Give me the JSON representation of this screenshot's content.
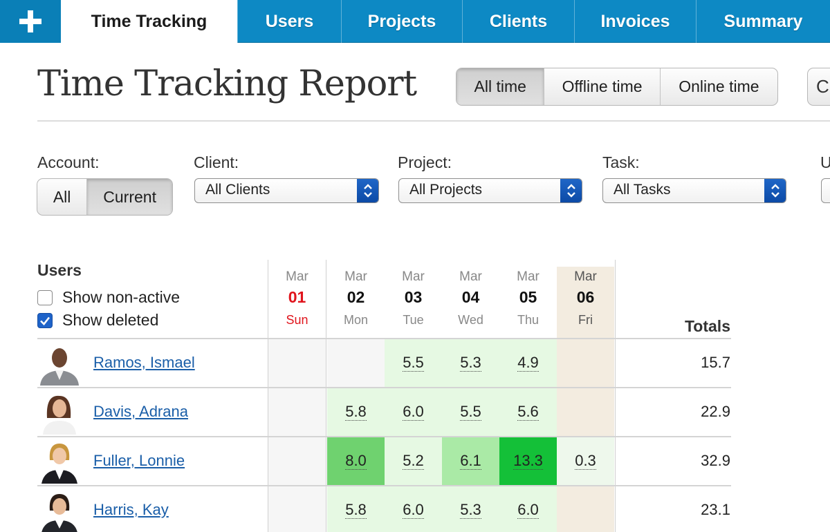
{
  "nav": {
    "add_icon": "plus-icon",
    "tabs": [
      {
        "label": "Time Tracking",
        "active": true
      },
      {
        "label": "Users"
      },
      {
        "label": "Projects"
      },
      {
        "label": "Clients"
      },
      {
        "label": "Invoices"
      },
      {
        "label": "Summary"
      }
    ]
  },
  "page": {
    "title": "Time Tracking Report",
    "time_filter": [
      {
        "label": "All time",
        "selected": true
      },
      {
        "label": "Offline time"
      },
      {
        "label": "Online time"
      }
    ],
    "cut_button_glyph": "C"
  },
  "filters": {
    "account_label": "Account:",
    "account_options": [
      {
        "label": "All"
      },
      {
        "label": "Current",
        "selected": true
      }
    ],
    "client_label": "Client:",
    "client_value": "All Clients",
    "project_label": "Project:",
    "project_value": "All Projects",
    "task_label": "Task:",
    "task_value": "All Tasks",
    "cut_label": "U"
  },
  "users_panel": {
    "heading": "Users",
    "show_nonactive_label": "Show non-active",
    "show_nonactive_checked": false,
    "show_deleted_label": "Show deleted",
    "show_deleted_checked": true
  },
  "grid": {
    "days": [
      {
        "month": "Mar",
        "day": "01",
        "weekday": "Sun"
      },
      {
        "month": "Mar",
        "day": "02",
        "weekday": "Mon"
      },
      {
        "month": "Mar",
        "day": "03",
        "weekday": "Tue"
      },
      {
        "month": "Mar",
        "day": "04",
        "weekday": "Wed"
      },
      {
        "month": "Mar",
        "day": "05",
        "weekday": "Thu"
      },
      {
        "month": "Mar",
        "day": "06",
        "weekday": "Fri"
      }
    ],
    "totals_label": "Totals",
    "rows": [
      {
        "name": "Ramos, Ismael",
        "hours": [
          "",
          "",
          "5.5",
          "5.3",
          "4.9",
          ""
        ],
        "total": "15.7"
      },
      {
        "name": "Davis, Adrana",
        "hours": [
          "",
          "5.8",
          "6.0",
          "5.5",
          "5.6",
          ""
        ],
        "total": "22.9"
      },
      {
        "name": "Fuller, Lonnie",
        "hours": [
          "",
          "8.0",
          "5.2",
          "6.1",
          "13.3",
          "0.3"
        ],
        "total": "32.9"
      },
      {
        "name": "Harris, Kay",
        "hours": [
          "",
          "5.8",
          "6.0",
          "5.3",
          "6.0",
          ""
        ],
        "total": "23.1"
      }
    ]
  },
  "colors": {
    "nav_blue": "#0d89c4",
    "link_blue": "#1a5ea8",
    "sunday_red": "#e0141c",
    "friday_bg": "#f3ece0"
  }
}
